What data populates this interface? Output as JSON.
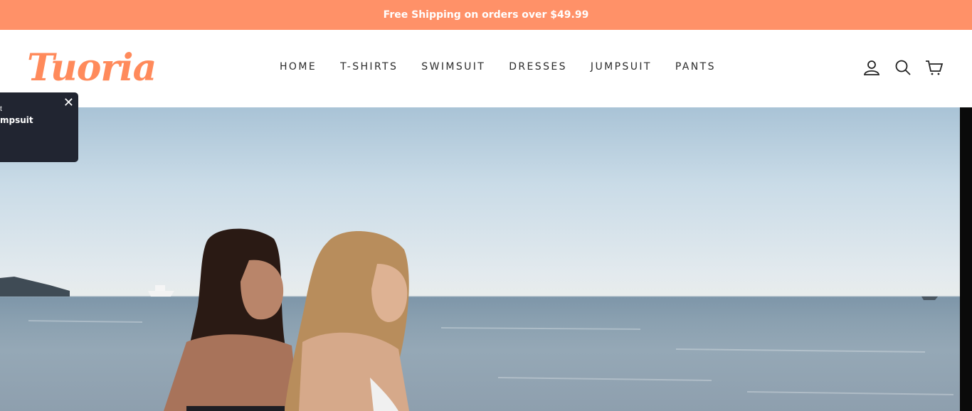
{
  "announcement": "Free Shipping on orders over $49.99",
  "logo": "Tuoria",
  "nav": [
    "HOME",
    "T-SHIRTS",
    "SWIMSUIT",
    "DRESSES",
    "JUMPSUIT",
    "PANTS"
  ],
  "header_icons": [
    "account-icon",
    "search-icon",
    "cart-icon"
  ],
  "popup": {
    "text": "mpsuit",
    "mark": "t",
    "close": "✕"
  },
  "colors": {
    "accent": "#ff9168",
    "popup_bg": "#212531"
  }
}
